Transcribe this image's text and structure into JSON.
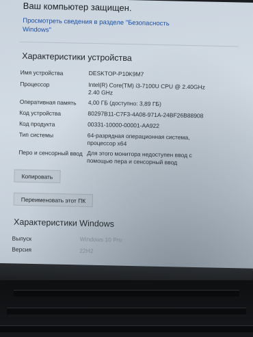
{
  "security": {
    "status": "Ваш компьютер защищен.",
    "link": "Просмотреть сведения в разделе \"Безопасность Windows\""
  },
  "device": {
    "title": "Характеристики устройства",
    "rows": [
      {
        "label": "Имя устройства",
        "value": "DESKTOP-P10K9M7"
      },
      {
        "label": "Процессор",
        "value": "Intel(R) Core(TM) i3-7100U CPU @ 2.40GHz 2.40 GHz"
      },
      {
        "label": "Оперативная память",
        "value": "4,00 ГБ (доступно: 3,89 ГБ)"
      },
      {
        "label": "Код устройства",
        "value": "80297B11-C7F3-4A08-971A-24BF26B88908"
      },
      {
        "label": "Код продукта",
        "value": "00331-10000-00001-AA922"
      },
      {
        "label": "Тип системы",
        "value": "64-разрядная операционная система, процессор x64"
      },
      {
        "label": "Перо и сенсорный ввод",
        "value": "Для этого монитора недоступен ввод с помощью пера и сенсорный ввод"
      }
    ],
    "copy_label": "Копировать",
    "rename_label": "Переименовать этот ПК"
  },
  "windows": {
    "title": "Характеристики Windows",
    "rows": [
      {
        "label": "Выпуск",
        "value": "Windows 10 Pro"
      },
      {
        "label": "Версия",
        "value": "22H2"
      }
    ]
  }
}
